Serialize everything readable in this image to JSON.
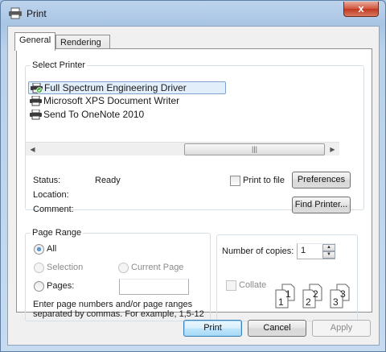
{
  "window": {
    "title": "Print",
    "close_glyph": "x"
  },
  "tabs": [
    {
      "label": "General"
    },
    {
      "label": "Rendering"
    }
  ],
  "select_printer": {
    "legend": "Select Printer",
    "printers": [
      {
        "label": "Full Spectrum Engineering Driver",
        "icon": "printer-default-icon"
      },
      {
        "label": "Microsoft XPS Document Writer",
        "icon": "printer-icon"
      },
      {
        "label": "Send To OneNote 2010",
        "icon": "printer-icon"
      }
    ],
    "status_label": "Status:",
    "status_value": "Ready",
    "location_label": "Location:",
    "comment_label": "Comment:",
    "print_to_file_label": "Print to file",
    "preferences_label": "Preferences",
    "find_printer_label": "Find Printer..."
  },
  "page_range": {
    "legend": "Page Range",
    "all_label": "All",
    "selection_label": "Selection",
    "current_page_label": "Current Page",
    "pages_label": "Pages:",
    "pages_value": "",
    "hint_line1": "Enter page numbers and/or page ranges",
    "hint_line2": "separated by commas.  For example, 1,5-12"
  },
  "copies": {
    "label": "Number of copies:",
    "value": "1",
    "collate_label": "Collate",
    "collate_digits": [
      "1",
      "1",
      "2",
      "2",
      "3",
      "3"
    ]
  },
  "buttons": {
    "print": "Print",
    "cancel": "Cancel",
    "apply": "Apply"
  },
  "colors": {
    "title_bar": "#a9c5e4",
    "close_button": "#c0381f",
    "selection_highlight": "#e3eefb",
    "default_button_border": "#3c7fb1"
  }
}
